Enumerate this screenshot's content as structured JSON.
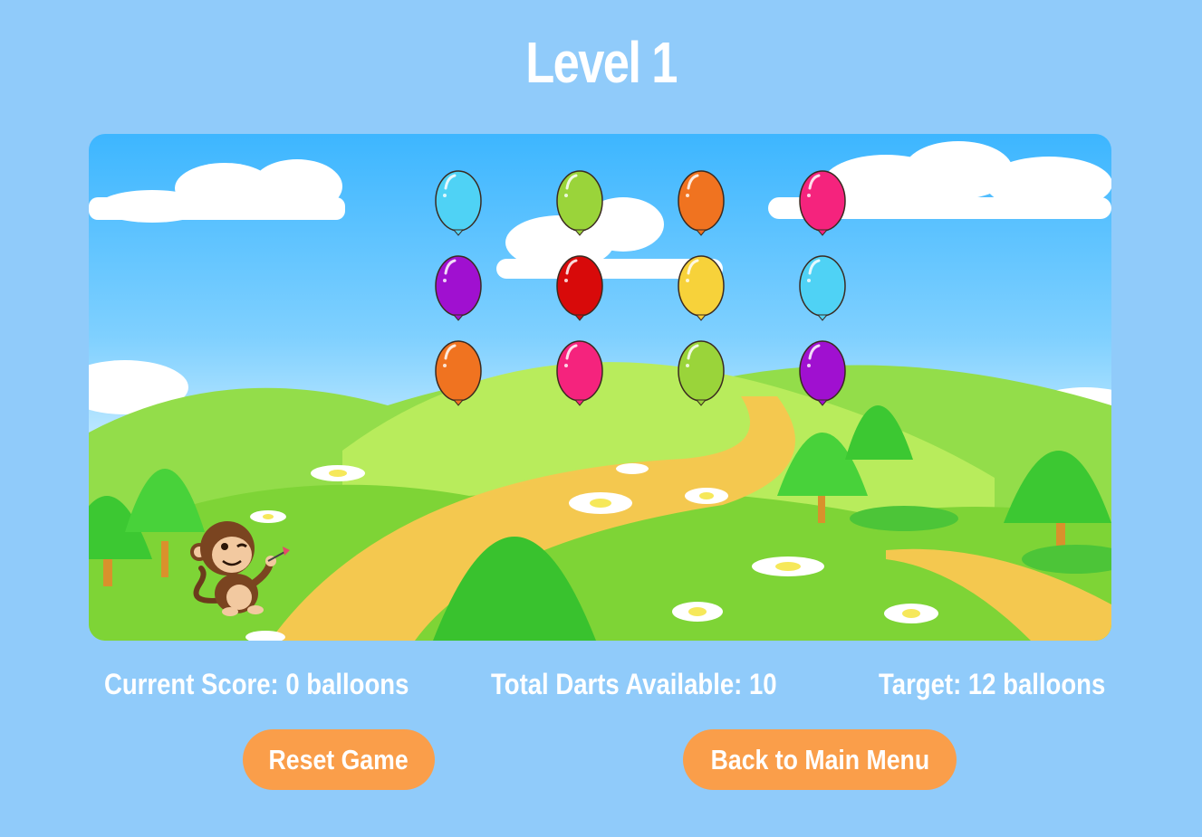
{
  "header": {
    "title": "Level 1"
  },
  "game": {
    "balloon_colors": [
      "#4fd2f5",
      "#9ad43a",
      "#f07320",
      "#f5237d",
      "#a010d0",
      "#d80a0a",
      "#f7d23a",
      "#4fd2f5",
      "#f07320",
      "#f5237d",
      "#9ad43a",
      "#a010d0"
    ],
    "balloon_count": 12,
    "player_icon": "monkey-with-dart"
  },
  "stats": {
    "score": "Current Score: 0 balloons",
    "darts": "Total Darts Available: 10",
    "target": "Target: 12 balloons"
  },
  "buttons": {
    "reset": "Reset Game",
    "menu": "Back to Main Menu"
  },
  "colors": {
    "background": "#90cbfa",
    "button": "#fa9e4a",
    "text": "#ffffff"
  }
}
